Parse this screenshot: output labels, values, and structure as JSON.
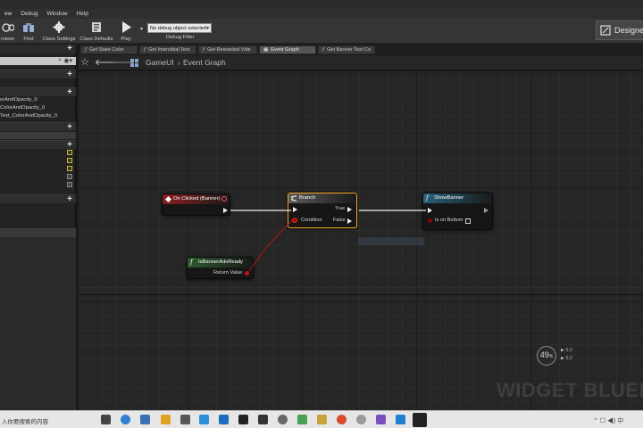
{
  "menu": {
    "items": [
      "ew",
      "Debug",
      "Window",
      "Help"
    ]
  },
  "toolbar": {
    "buttons": [
      "rowse",
      "Find",
      "Class Settings",
      "Class Defaults",
      "Play"
    ],
    "debug_select": "No debug object selected",
    "debug_filter": "Debug Filter",
    "designer": "Designe"
  },
  "left_panel": {
    "items": [
      "orAndOpacity_0",
      "ColorAndOpacity_0",
      "Text_ColorAndOpacity_0"
    ]
  },
  "tabs": [
    {
      "label": "Get State Color",
      "active": false
    },
    {
      "label": "Get Interstitial Text",
      "active": false
    },
    {
      "label": "Get Rewarded Vide",
      "active": false
    },
    {
      "label": "Event Graph",
      "active": true
    },
    {
      "label": "Get Banner Text Co",
      "active": false
    }
  ],
  "breadcrumb": {
    "root": "GameUI",
    "separator": "›",
    "leaf": "Event Graph"
  },
  "nodes": {
    "event": {
      "title": "On Clicked (Banner)",
      "color": "#8b1e1e"
    },
    "branch": {
      "title": "Branch",
      "true_label": "True",
      "false_label": "False",
      "condition_label": "Condition",
      "color": "#5a5a5a",
      "selected_color": "#f5a623"
    },
    "show_banner": {
      "title": "ShowBanner",
      "param_label": "Is on Bottom",
      "color": "#2a5f7a"
    },
    "is_ready": {
      "title": "IsBannerAdsReady",
      "return_label": "Return Value",
      "color": "#2e5a2e"
    }
  },
  "zoom": {
    "value": "49",
    "suffix": "%",
    "line1": "0.2",
    "line2": "0.2"
  },
  "watermark": "WIDGET BLUEP",
  "taskbar": {
    "search_text": "入你要搜索的内容"
  },
  "icons": [
    "search-icon",
    "binoculars-icon",
    "gear-icon",
    "play-icon",
    "event-icon",
    "branch-icon",
    "function-icon",
    "star-icon",
    "back-arrow-icon",
    "forward-arrow-icon",
    "grid-icon"
  ]
}
